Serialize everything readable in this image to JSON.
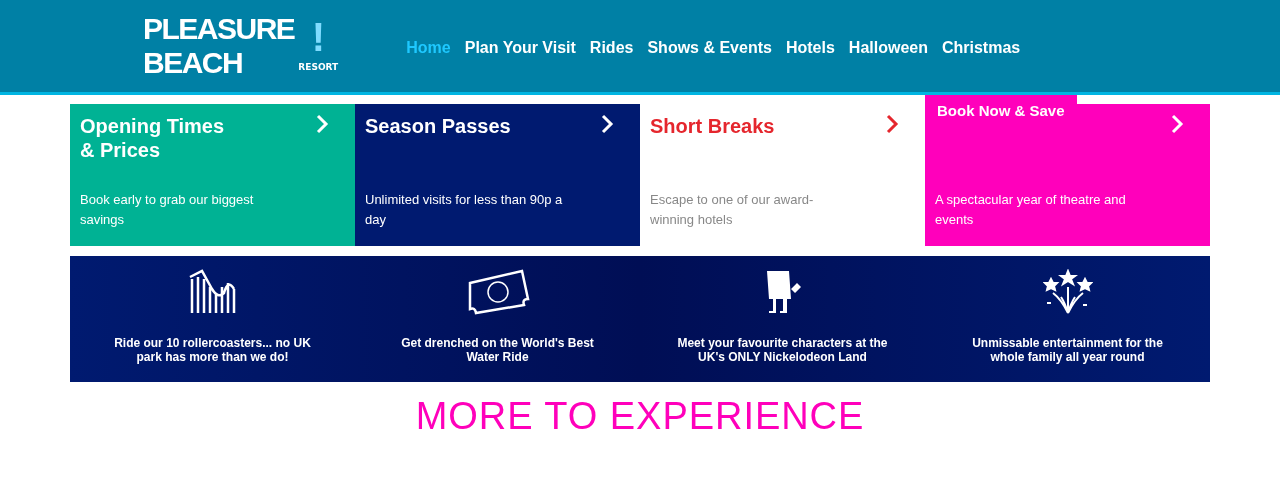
{
  "logo": {
    "line_1": "PLEASURE",
    "line_2": "BEACH",
    "mark": "!",
    "badge": "RESORT"
  },
  "nav": [
    {
      "label": "Home",
      "selected": true
    },
    {
      "label": "Plan Your Visit",
      "selected": false
    },
    {
      "label": "Rides",
      "selected": false
    },
    {
      "label": "Shows & Events",
      "selected": false
    },
    {
      "label": "Hotels",
      "selected": false
    },
    {
      "label": "Halloween",
      "selected": false
    },
    {
      "label": "Christmas",
      "selected": false
    }
  ],
  "cards": [
    {
      "title": "Opening Times\n& Prices",
      "text": "Book early to grab our biggest savings",
      "color": "#00b294",
      "kind": "dark"
    },
    {
      "title": "Season Passes",
      "text": "Unlimited visits for less than 90p a day",
      "color": "#001a70",
      "kind": "dark"
    },
    {
      "title": "Short Breaks",
      "text": "Escape to one of our award-winning hotels",
      "color": "#ffffff",
      "kind": "light"
    },
    {
      "text": "A spectacular year of theatre and events",
      "color": "#ff00bb",
      "kind": "dark",
      "badge": "Book Now & Save"
    }
  ],
  "features": [
    {
      "kind": "coaster",
      "text": "Ride our 10 rollercoasters... no UK park has more than we do!"
    },
    {
      "kind": "ticket",
      "text": "Get drenched on the World's Best Water Ride"
    },
    {
      "kind": "character",
      "text": "Meet your favourite characters at the UK's ONLY Nickelodeon Land"
    },
    {
      "kind": "fireworks",
      "text": "Unmissable entertainment for the whole family all year round"
    }
  ],
  "heading": "MORE TO EXPERIENCE"
}
